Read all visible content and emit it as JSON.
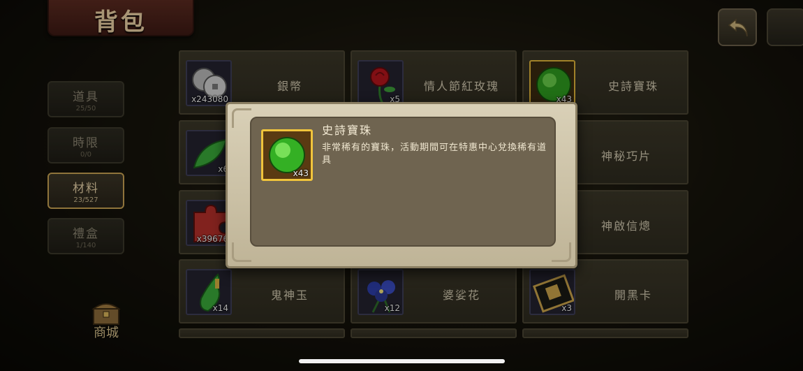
{
  "screen": {
    "title": "背包"
  },
  "sidebar": {
    "tabs": [
      {
        "label": "道具",
        "count": "25/50",
        "active": false
      },
      {
        "label": "時限",
        "count": "0/0",
        "active": false
      },
      {
        "label": "材料",
        "count": "23/527",
        "active": true
      },
      {
        "label": "禮盒",
        "count": "1/140",
        "active": false
      }
    ],
    "shop_label": "商城"
  },
  "buttons": {
    "back_icon": "return-arrow-icon"
  },
  "grid": {
    "items": [
      {
        "name": "銀幣",
        "qty": "x243080",
        "icon": "silver-coins-icon"
      },
      {
        "name": "情人節紅玫瑰",
        "qty": "x5",
        "icon": "red-rose-icon"
      },
      {
        "name": "史詩寶珠",
        "qty": "x43",
        "icon": "green-orb-icon",
        "highlight": true
      },
      {
        "name": "神秘巧片",
        "qty": "x6",
        "icon": "green-leaf-icon"
      },
      {
        "name": "神啟信熜",
        "qty": "x39676",
        "icon": "puzzle-piece-icon"
      },
      {
        "name": "鬼神玉",
        "qty": "x14",
        "icon": "jade-icon"
      },
      {
        "name": "婆娑花",
        "qty": "x12",
        "icon": "blue-flower-icon"
      },
      {
        "name": "開黑卡",
        "qty": "x3",
        "icon": "black-card-icon"
      }
    ]
  },
  "detail_modal": {
    "item_name": "史詩寶珠",
    "qty": "x43",
    "description": "非常稀有的寶珠，活動期間可在特惠中心兌換稀有道具",
    "icon": "green-orb-icon"
  },
  "colors": {
    "accent_gold": "#e0b43a",
    "modal_bg": "#d9d0b7",
    "modal_inner": "#6f6450",
    "text_light": "#cfc6ad"
  }
}
